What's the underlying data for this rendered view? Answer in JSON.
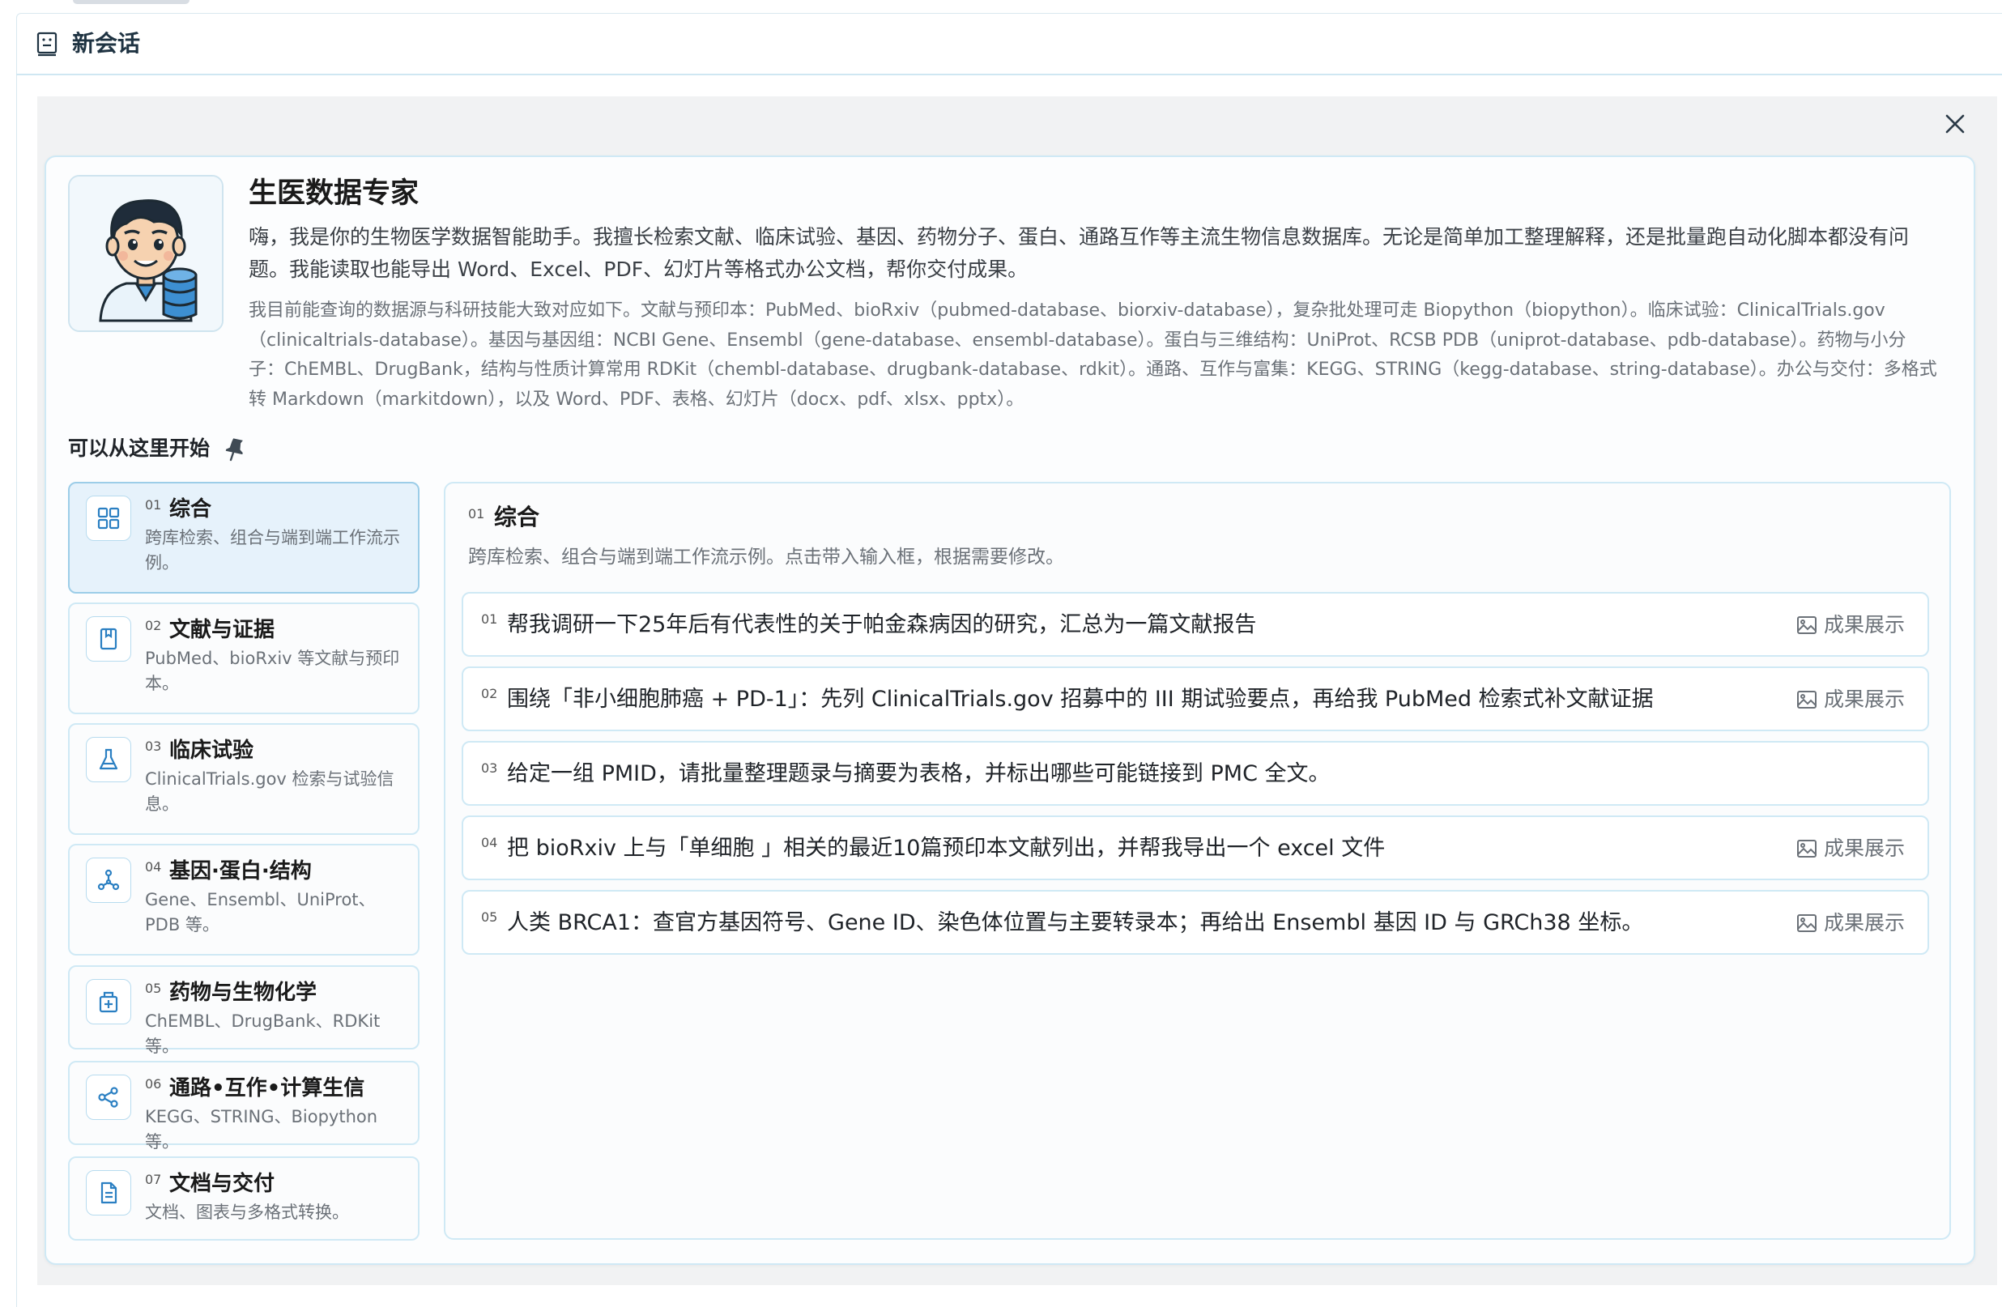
{
  "header": {
    "title": "新会话"
  },
  "bot": {
    "name": "生医数据专家",
    "description": "嗨，我是你的生物医学数据智能助手。我擅长检索文献、临床试验、基因、药物分子、蛋白、通路互作等主流生物信息数据库。无论是简单加工整理解释，还是批量跑自动化脚本都没有问题。我能读取也能导出 Word、Excel、PDF、幻灯片等格式办公文档，帮你交付成果。",
    "details": "我目前能查询的数据源与科研技能大致对应如下。文献与预印本：PubMed、bioRxiv（pubmed-database、biorxiv-database），复杂批处理可走 Biopython（biopython）。临床试验：ClinicalTrials.gov（clinicaltrials-database）。基因与基因组：NCBI Gene、Ensembl（gene-database、ensembl-database）。蛋白与三维结构：UniProt、RCSB PDB（uniprot-database、pdb-database）。药物与小分子：ChEMBL、DrugBank，结构与性质计算常用 RDKit（chembl-database、drugbank-database、rdkit）。通路、互作与富集：KEGG、STRING（kegg-database、string-database）。办公与交付：多格式转 Markdown（markitdown），以及 Word、PDF、表格、幻灯片（docx、pdf、xlsx、pptx）。"
  },
  "start_label": "可以从这里开始",
  "categories": [
    {
      "num": "01",
      "title": "综合",
      "desc": "跨库检索、组合与端到端工作流示例。",
      "icon": "grid-icon",
      "active": true
    },
    {
      "num": "02",
      "title": "文献与证据",
      "desc": "PubMed、bioRxiv 等文献与预印本。",
      "icon": "bookmark-icon"
    },
    {
      "num": "03",
      "title": "临床试验",
      "desc": "ClinicalTrials.gov 检索与试验信息。",
      "icon": "flask-icon"
    },
    {
      "num": "04",
      "title": "基因·蛋白·结构",
      "desc": "Gene、Ensembl、UniProt、PDB 等。",
      "icon": "molecule-icon"
    },
    {
      "num": "05",
      "title": "药物与生物化学",
      "desc": "ChEMBL、DrugBank、RDKit 等。",
      "icon": "medicine-icon"
    },
    {
      "num": "06",
      "title": "通路•互作•计算生信",
      "desc": "KEGG、STRING、Biopython 等。",
      "icon": "share-icon"
    },
    {
      "num": "07",
      "title": "文档与交付",
      "desc": "文档、图表与多格式转换。",
      "icon": "document-icon"
    }
  ],
  "panel": {
    "num": "01",
    "title": "综合",
    "desc": "跨库检索、组合与端到端工作流示例。点击带入输入框，根据需要修改。",
    "prompts": [
      {
        "num": "01",
        "text": "帮我调研一下25年后有代表性的关于帕金森病因的研究，汇总为一篇文献报告",
        "result": "成果展示"
      },
      {
        "num": "02",
        "text": "围绕「非小细胞肺癌 + PD-1」：先列 ClinicalTrials.gov 招募中的 III 期试验要点，再给我 PubMed 检索式补文献证据",
        "result": "成果展示"
      },
      {
        "num": "03",
        "text": "给定一组 PMID，请批量整理题录与摘要为表格，并标出哪些可能链接到 PMC 全文。",
        "result": ""
      },
      {
        "num": "04",
        "text": "把 bioRxiv 上与「单细胞 」相关的最近10篇预印本文献列出，并帮我导出一个 excel 文件",
        "result": "成果展示"
      },
      {
        "num": "05",
        "text": "人类 BRCA1：查官方基因符号、Gene ID、染色体位置与主要转录本；再给出 Ensembl 基因 ID 与 GRCh38 坐标。",
        "result": "成果展示"
      }
    ]
  },
  "colors": {
    "accent": "#2a7fc2",
    "border": "#cfe9f5",
    "active_bg": "#e6f2fb"
  }
}
